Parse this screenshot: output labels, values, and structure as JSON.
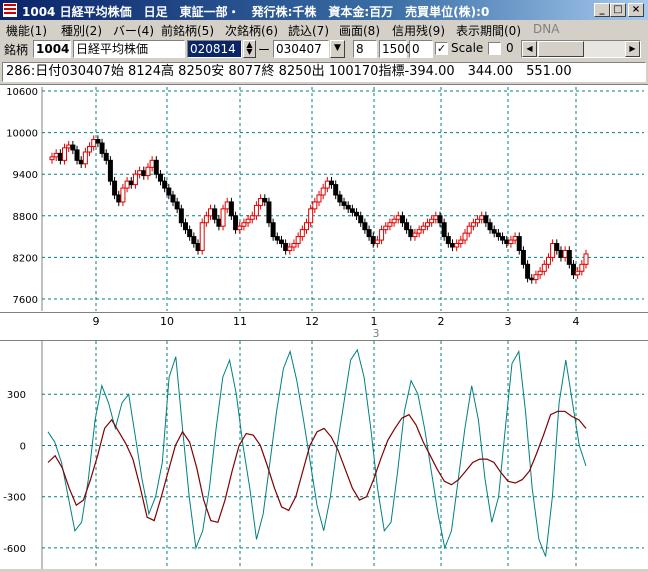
{
  "window": {
    "title": "1004 日経平均株価　日足　東証一部・　発行株:千株　資本金:百万　売買単位(株):0",
    "controls": [
      "_",
      "□",
      "×"
    ]
  },
  "menu": [
    "機能(1)",
    "種別(2)",
    "バー(4)",
    "前銘柄(5)",
    "次銘柄(6)",
    "読込(7)",
    "画面(8)",
    "信用残(9)",
    "表示期間(0)",
    "DNA"
  ],
  "toolbar": {
    "label": "銘柄",
    "code": "1004",
    "name": "日経平均株価",
    "from_date": "020814",
    "dash": "ー",
    "to_date": "030407",
    "dropdown_arrow": "▼",
    "val1": "8",
    "val2": "1500",
    "val3": "0",
    "scale_checked": "✓",
    "scale_label": "Scale",
    "val4": "0"
  },
  "status": "286:日付030407始 8124高 8250安 8077終 8250出 100170指標-394.00　344.00　551.00",
  "price_axis": [
    "10600",
    "10000",
    "9400",
    "8800",
    "8200",
    "7600"
  ],
  "month_labels": [
    "9",
    "10",
    "11",
    "12",
    "1",
    "2",
    "3",
    "4"
  ],
  "month_marker": "3",
  "osc_axis": [
    "300",
    "0",
    "-300",
    "-600"
  ],
  "colors": {
    "up": "#e00000",
    "down": "#000000",
    "grid": "#008080",
    "osc_fast": "#008080",
    "osc_slow": "#800000"
  },
  "chart_data": {
    "type": "candlestick",
    "ylim": [
      7600,
      10600
    ],
    "osc_ylim": [
      -700,
      600
    ],
    "closes": [
      9650,
      9700,
      9600,
      9780,
      9820,
      9750,
      9600,
      9550,
      9720,
      9800,
      9900,
      9850,
      9700,
      9600,
      9300,
      9100,
      9000,
      9200,
      9300,
      9250,
      9400,
      9450,
      9380,
      9500,
      9600,
      9400,
      9300,
      9200,
      9100,
      9000,
      8900,
      8700,
      8600,
      8500,
      8400,
      8300,
      8700,
      8800,
      8900,
      8750,
      8650,
      8900,
      9000,
      8800,
      8600,
      8650,
      8700,
      8750,
      8800,
      8950,
      9050,
      9000,
      8700,
      8500,
      8450,
      8400,
      8300,
      8350,
      8400,
      8500,
      8600,
      8700,
      8900,
      9000,
      9100,
      9200,
      9300,
      9250,
      9100,
      9000,
      8950,
      8900,
      8850,
      8800,
      8700,
      8600,
      8500,
      8400,
      8450,
      8600,
      8650,
      8700,
      8750,
      8800,
      8700,
      8600,
      8500,
      8550,
      8600,
      8650,
      8700,
      8750,
      8800,
      8700,
      8500,
      8400,
      8350,
      8400,
      8450,
      8550,
      8650,
      8700,
      8750,
      8800,
      8700,
      8600,
      8550,
      8500,
      8450,
      8400,
      8450,
      8500,
      8300,
      8100,
      7900,
      7880,
      7950,
      8000,
      8100,
      8200,
      8400,
      8300,
      8200,
      8300,
      8100,
      7950,
      8000,
      8100,
      8250
    ],
    "osc_fast": [
      80,
      20,
      -100,
      -300,
      -500,
      -450,
      -200,
      150,
      350,
      250,
      100,
      250,
      300,
      50,
      -200,
      -400,
      -300,
      -100,
      400,
      520,
      100,
      -300,
      -600,
      -500,
      -250,
      100,
      400,
      500,
      300,
      0,
      -250,
      -550,
      -400,
      -100,
      200,
      450,
      550,
      380,
      150,
      -100,
      -350,
      -500,
      -300,
      0,
      250,
      500,
      560,
      400,
      100,
      -250,
      -500,
      -450,
      -150,
      200,
      380,
      300,
      100,
      -150,
      -400,
      -600,
      -500,
      -200,
      100,
      350,
      150,
      -200,
      -450,
      -300,
      100,
      480,
      550,
      200,
      -250,
      -550,
      -650,
      -300,
      250,
      500,
      250,
      0,
      -120
    ],
    "osc_slow": [
      -100,
      -60,
      -130,
      -250,
      -350,
      -320,
      -200,
      -60,
      100,
      150,
      80,
      10,
      -80,
      -240,
      -420,
      -440,
      -300,
      -150,
      0,
      80,
      20,
      -130,
      -320,
      -440,
      -450,
      -320,
      -150,
      0,
      70,
      60,
      0,
      -120,
      -250,
      -360,
      -380,
      -300,
      -150,
      0,
      80,
      100,
      50,
      -30,
      -140,
      -250,
      -320,
      -300,
      -200,
      -80,
      30,
      100,
      160,
      180,
      120,
      20,
      -60,
      -140,
      -210,
      -230,
      -200,
      -150,
      -100,
      -80,
      -80,
      -100,
      -160,
      -210,
      -220,
      -200,
      -150,
      -50,
      60,
      180,
      200,
      200,
      170,
      150,
      100
    ]
  }
}
